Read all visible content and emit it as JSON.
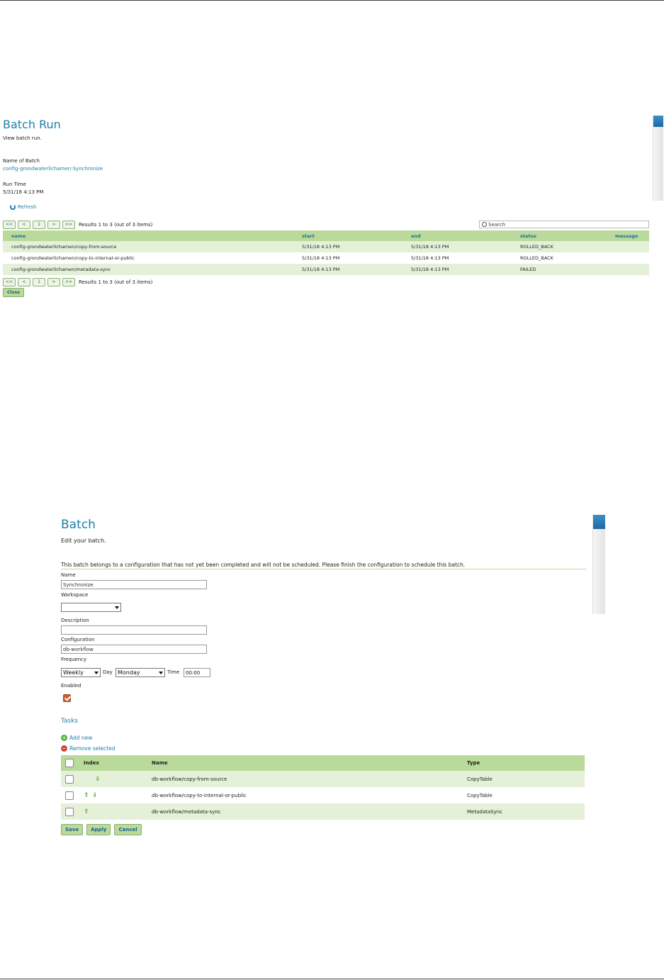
{
  "batch_run": {
    "title": "Batch Run",
    "subtitle": "View batch run.",
    "name_label": "Name of Batch",
    "name_value": "config-grondwaterlichamen:Synchronize",
    "runtime_label": "Run Time",
    "runtime_value": "5/31/18 4:13 PM",
    "refresh_label": "Refresh",
    "pager": {
      "first": "<<",
      "prev": "<",
      "page": "1",
      "next": ">",
      "last": ">>",
      "results": "Results 1 to 3 (out of 3 items)"
    },
    "search_placeholder": "Search",
    "columns": [
      "name",
      "start",
      "end",
      "status",
      "message"
    ],
    "rows": [
      {
        "name": "config-grondwaterlichamen/copy-from-source",
        "start": "5/31/18 4:13 PM",
        "end": "5/31/18 4:13 PM",
        "status": "ROLLED_BACK",
        "message": ""
      },
      {
        "name": "config-grondwaterlichamen/copy-to-internal-or-public",
        "start": "5/31/18 4:13 PM",
        "end": "5/31/18 4:13 PM",
        "status": "ROLLED_BACK",
        "message": ""
      },
      {
        "name": "config-grondwaterlichamen/metadata-sync",
        "start": "5/31/18 4:13 PM",
        "end": "5/31/18 4:13 PM",
        "status": "FAILED",
        "message": ""
      }
    ],
    "close_label": "Close"
  },
  "batch_edit": {
    "title": "Batch",
    "subtitle": "Edit your batch.",
    "notice": "This batch belongs to a configuration that has not yet been completed and will not be scheduled. Please finish the configuration to schedule this batch.",
    "name_label": "Name",
    "name_value": "Synchronize",
    "workspace_label": "Workspace",
    "workspace_value": "",
    "description_label": "Description",
    "description_value": "",
    "configuration_label": "Configuration",
    "configuration_value": "db-workflow",
    "frequency_label": "Frequency",
    "frequency_value": "Weekly",
    "day_label": "Day",
    "day_value": "Monday",
    "time_label": "Time",
    "time_value": "00:00",
    "enabled_label": "Enabled",
    "enabled": true,
    "tasks_heading": "Tasks",
    "add_new_label": "Add new",
    "remove_selected_label": "Remove selected",
    "task_columns": [
      "Index",
      "Name",
      "Type"
    ],
    "tasks": [
      {
        "name": "db-workflow/copy-from-source",
        "type": "CopyTable"
      },
      {
        "name": "db-workflow/copy-to-internal-or-public",
        "type": "CopyTable"
      },
      {
        "name": "db-workflow/metadata-sync",
        "type": "MetadataSync"
      }
    ],
    "save_label": "Save",
    "apply_label": "Apply",
    "cancel_label": "Cancel"
  }
}
